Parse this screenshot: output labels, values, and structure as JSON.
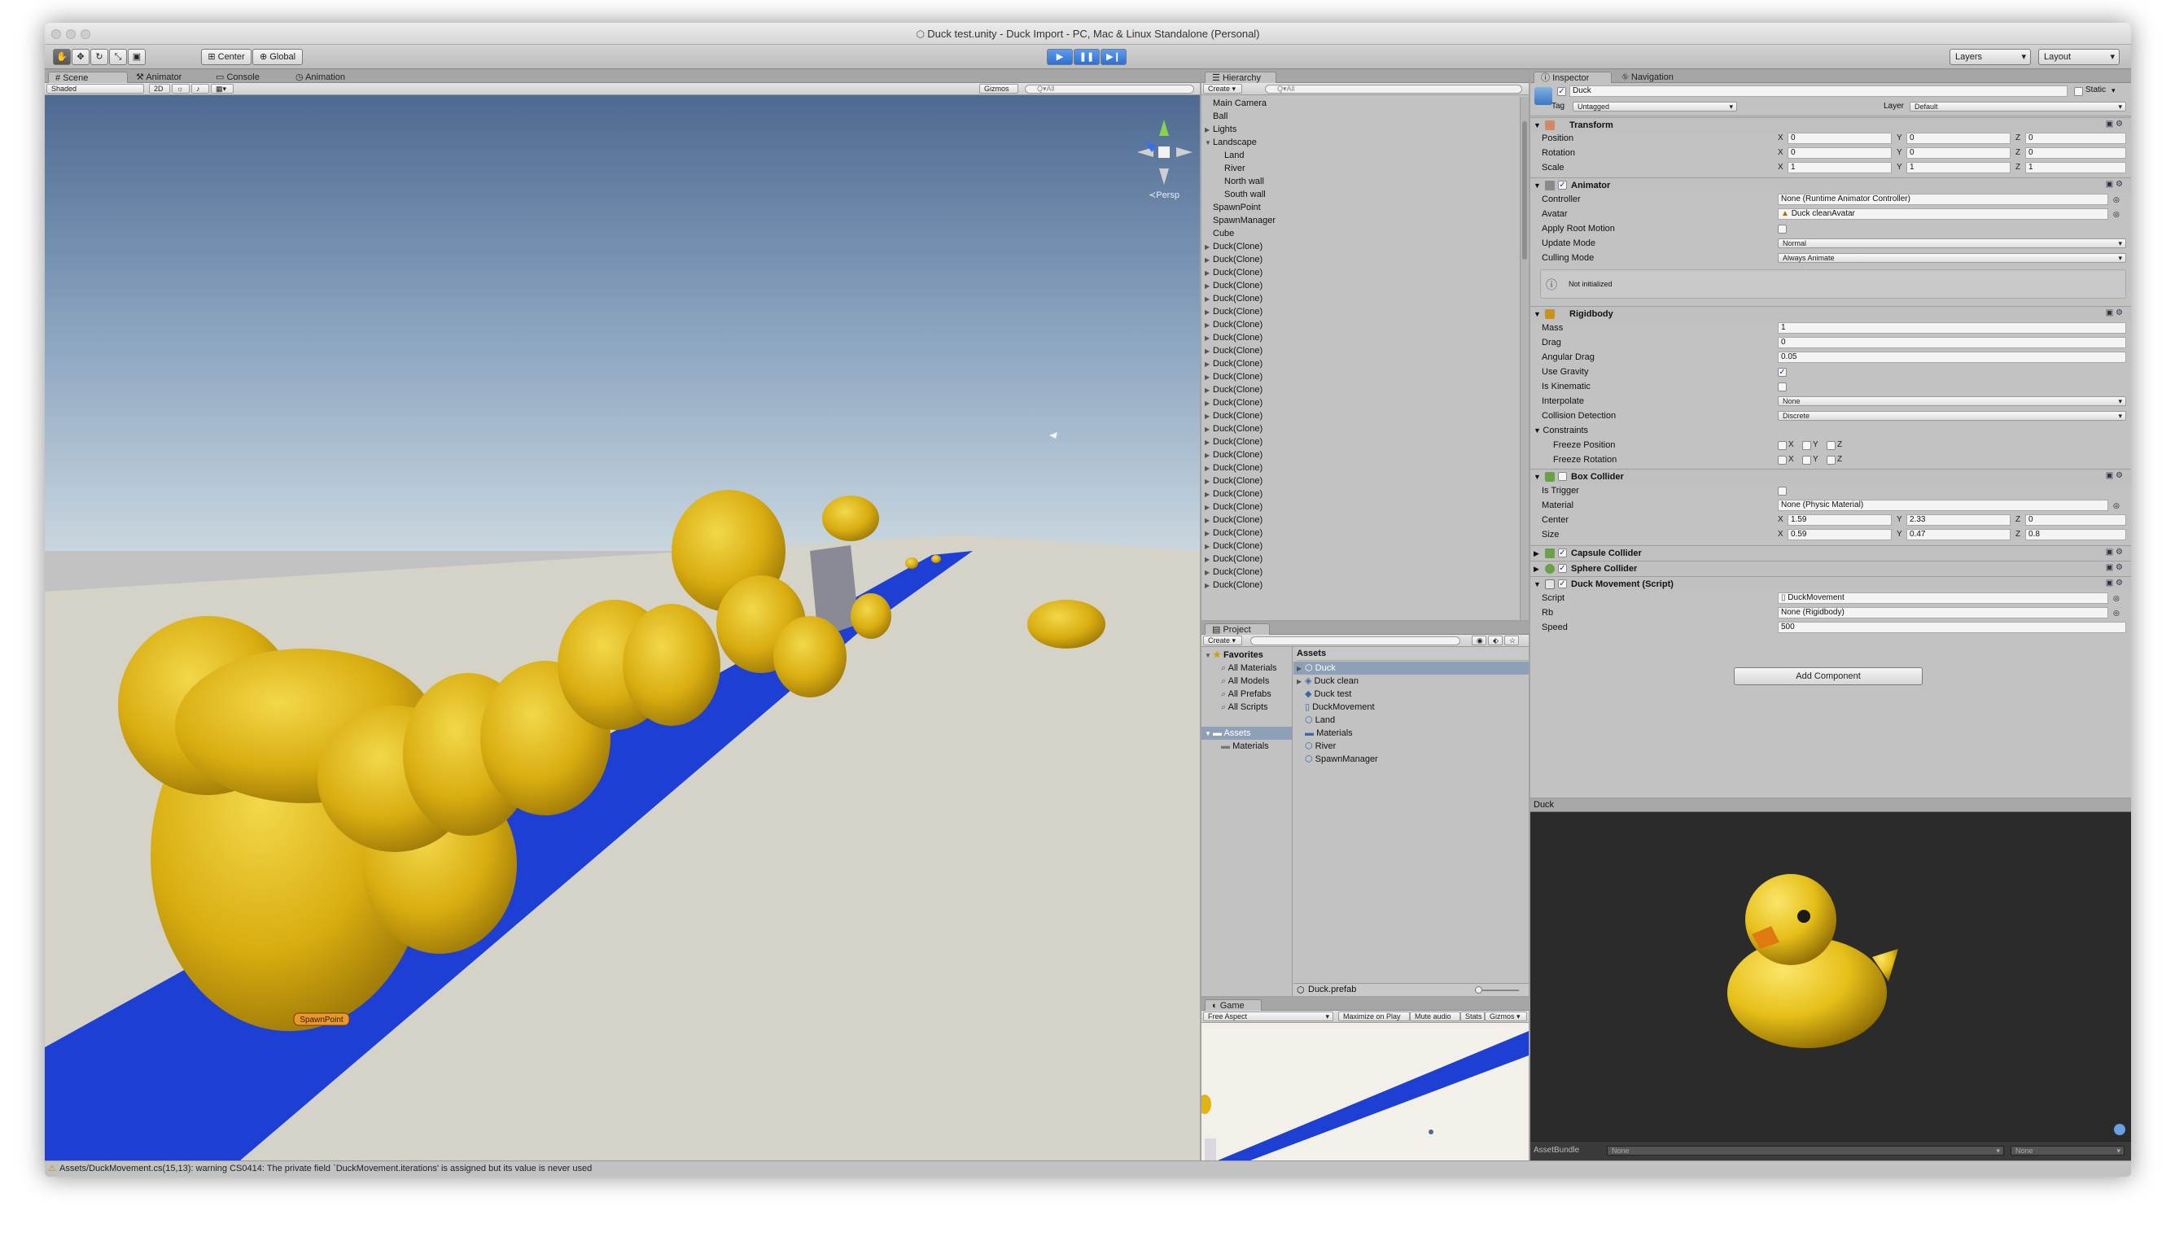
{
  "window": {
    "title": "Duck test.unity - Duck Import - PC, Mac & Linux Standalone (Personal)"
  },
  "toolbar": {
    "center": "Center",
    "global": "Global",
    "layers": "Layers",
    "layout": "Layout",
    "play_icon": "play-icon",
    "pause_icon": "pause-icon",
    "step_icon": "step-icon"
  },
  "scene": {
    "tabs": [
      "Scene",
      "Animator",
      "Console",
      "Animation"
    ],
    "shading": "Shaded",
    "mode2d": "2D",
    "gizmos": "Gizmos",
    "search_placeholder": "Q▾All",
    "persp": "≺Persp",
    "spawn_label": "SpawnPoint",
    "sky_top": "#4e6a92",
    "sky_bottom": "#c9d6df",
    "ground": "#d5d2c8",
    "river": "#1d3fd4",
    "duck": "#e0b513"
  },
  "hierarchy": {
    "tab": "Hierarchy",
    "create": "Create",
    "search_placeholder": "Q▾All",
    "items": [
      {
        "label": "Main Camera",
        "indent": 0,
        "arrow": ""
      },
      {
        "label": "Ball",
        "indent": 0,
        "arrow": ""
      },
      {
        "label": "Lights",
        "indent": 0,
        "arrow": "▶"
      },
      {
        "label": "Landscape",
        "indent": 0,
        "arrow": "▼"
      },
      {
        "label": "Land",
        "indent": 1,
        "arrow": ""
      },
      {
        "label": "River",
        "indent": 1,
        "arrow": ""
      },
      {
        "label": "North wall",
        "indent": 1,
        "arrow": ""
      },
      {
        "label": "South wall",
        "indent": 1,
        "arrow": ""
      },
      {
        "label": "SpawnPoint",
        "indent": 0,
        "arrow": ""
      },
      {
        "label": "SpawnManager",
        "indent": 0,
        "arrow": ""
      },
      {
        "label": "Cube",
        "indent": 0,
        "arrow": ""
      },
      {
        "label": "Duck(Clone)",
        "indent": 0,
        "arrow": "▶"
      },
      {
        "label": "Duck(Clone)",
        "indent": 0,
        "arrow": "▶"
      },
      {
        "label": "Duck(Clone)",
        "indent": 0,
        "arrow": "▶"
      },
      {
        "label": "Duck(Clone)",
        "indent": 0,
        "arrow": "▶"
      },
      {
        "label": "Duck(Clone)",
        "indent": 0,
        "arrow": "▶"
      },
      {
        "label": "Duck(Clone)",
        "indent": 0,
        "arrow": "▶"
      },
      {
        "label": "Duck(Clone)",
        "indent": 0,
        "arrow": "▶"
      },
      {
        "label": "Duck(Clone)",
        "indent": 0,
        "arrow": "▶"
      },
      {
        "label": "Duck(Clone)",
        "indent": 0,
        "arrow": "▶"
      },
      {
        "label": "Duck(Clone)",
        "indent": 0,
        "arrow": "▶"
      },
      {
        "label": "Duck(Clone)",
        "indent": 0,
        "arrow": "▶"
      },
      {
        "label": "Duck(Clone)",
        "indent": 0,
        "arrow": "▶"
      },
      {
        "label": "Duck(Clone)",
        "indent": 0,
        "arrow": "▶"
      },
      {
        "label": "Duck(Clone)",
        "indent": 0,
        "arrow": "▶"
      },
      {
        "label": "Duck(Clone)",
        "indent": 0,
        "arrow": "▶"
      },
      {
        "label": "Duck(Clone)",
        "indent": 0,
        "arrow": "▶"
      },
      {
        "label": "Duck(Clone)",
        "indent": 0,
        "arrow": "▶"
      },
      {
        "label": "Duck(Clone)",
        "indent": 0,
        "arrow": "▶"
      },
      {
        "label": "Duck(Clone)",
        "indent": 0,
        "arrow": "▶"
      },
      {
        "label": "Duck(Clone)",
        "indent": 0,
        "arrow": "▶"
      },
      {
        "label": "Duck(Clone)",
        "indent": 0,
        "arrow": "▶"
      },
      {
        "label": "Duck(Clone)",
        "indent": 0,
        "arrow": "▶"
      },
      {
        "label": "Duck(Clone)",
        "indent": 0,
        "arrow": "▶"
      },
      {
        "label": "Duck(Clone)",
        "indent": 0,
        "arrow": "▶"
      },
      {
        "label": "Duck(Clone)",
        "indent": 0,
        "arrow": "▶"
      },
      {
        "label": "Duck(Clone)",
        "indent": 0,
        "arrow": "▶"
      },
      {
        "label": "Duck(Clone)",
        "indent": 0,
        "arrow": "▶"
      }
    ]
  },
  "project": {
    "tab": "Project",
    "create": "Create",
    "favorites_label": "Favorites",
    "favorites": [
      "All Materials",
      "All Models",
      "All Prefabs",
      "All Scripts"
    ],
    "tree_assets": "Assets",
    "tree_materials": "Materials",
    "assets_header": "Assets",
    "assets": [
      {
        "label": "Duck",
        "icon": "prefab-icon",
        "selected": true,
        "arrow": "▶"
      },
      {
        "label": "Duck clean",
        "icon": "model-icon",
        "selected": false,
        "arrow": "▶"
      },
      {
        "label": "Duck test",
        "icon": "unity-scene-icon",
        "selected": false,
        "arrow": ""
      },
      {
        "label": "DuckMovement",
        "icon": "script-icon",
        "selected": false,
        "arrow": ""
      },
      {
        "label": "Land",
        "icon": "prefab-icon",
        "selected": false,
        "arrow": ""
      },
      {
        "label": "Materials",
        "icon": "folder-icon",
        "selected": false,
        "arrow": ""
      },
      {
        "label": "River",
        "icon": "prefab-icon",
        "selected": false,
        "arrow": ""
      },
      {
        "label": "SpawnManager",
        "icon": "prefab-icon",
        "selected": false,
        "arrow": ""
      }
    ],
    "footer": "Duck.prefab"
  },
  "game": {
    "tab": "Game",
    "aspect": "Free Aspect",
    "buttons": [
      "Maximize on Play",
      "Mute audio",
      "Stats",
      "Gizmos"
    ]
  },
  "inspector": {
    "tabs": [
      "Inspector",
      "Navigation"
    ],
    "name": "Duck",
    "static": "Static",
    "tag_label": "Tag",
    "tag": "Untagged",
    "layer_label": "Layer",
    "layer": "Default",
    "transform": {
      "title": "Transform",
      "rows": [
        {
          "label": "Position",
          "x": "0",
          "y": "0",
          "z": "0"
        },
        {
          "label": "Rotation",
          "x": "0",
          "y": "0",
          "z": "0"
        },
        {
          "label": "Scale",
          "x": "1",
          "y": "1",
          "z": "1"
        }
      ]
    },
    "animator": {
      "title": "Animator",
      "controller_label": "Controller",
      "controller": "None (Runtime Animator Controller)",
      "avatar_label": "Avatar",
      "avatar": "Duck cleanAvatar",
      "apply_root_label": "Apply Root Motion",
      "update_label": "Update Mode",
      "update": "Normal",
      "culling_label": "Culling Mode",
      "culling": "Always Animate",
      "note": "Not initialized"
    },
    "rigidbody": {
      "title": "Rigidbody",
      "mass_label": "Mass",
      "mass": "1",
      "drag_label": "Drag",
      "drag": "0",
      "adrag_label": "Angular Drag",
      "adrag": "0.05",
      "gravity_label": "Use Gravity",
      "kinematic_label": "Is Kinematic",
      "interp_label": "Interpolate",
      "interp": "None",
      "coll_label": "Collision Detection",
      "coll": "Discrete",
      "constraints": "Constraints",
      "freeze_pos": "Freeze Position",
      "freeze_rot": "Freeze Rotation"
    },
    "box": {
      "title": "Box Collider",
      "trigger_label": "Is Trigger",
      "material_label": "Material",
      "material": "None (Physic Material)",
      "center_label": "Center",
      "cx": "1.59",
      "cy": "2.33",
      "cz": "0",
      "size_label": "Size",
      "sx": "0.59",
      "sy": "0.47",
      "sz": "0.8"
    },
    "capsule": {
      "title": "Capsule Collider"
    },
    "sphere": {
      "title": "Sphere Collider"
    },
    "movement": {
      "title": "Duck Movement (Script)",
      "script_label": "Script",
      "script": "DuckMovement",
      "rb_label": "Rb",
      "rb": "None (Rigidbody)",
      "speed_label": "Speed",
      "speed": "500"
    },
    "add_component": "Add Component"
  },
  "preview": {
    "title": "Duck",
    "assetbundle_label": "AssetBundle",
    "bundle": "None",
    "variant": "None"
  },
  "status": {
    "message": "Assets/DuckMovement.cs(15,13): warning CS0414: The private field `DuckMovement.iterations' is assigned but its value is never used"
  }
}
